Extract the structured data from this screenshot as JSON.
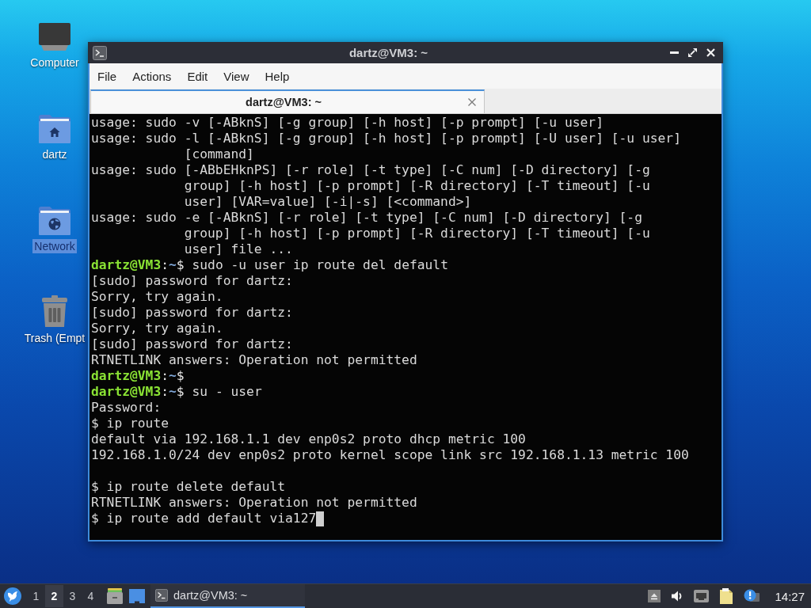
{
  "desktop_icons": [
    {
      "kind": "computer",
      "label": "Computer",
      "selected": false
    },
    {
      "kind": "home",
      "label": "dartz",
      "selected": false
    },
    {
      "kind": "network",
      "label": "Network",
      "selected": true
    },
    {
      "kind": "trash",
      "label": "Trash (Empt",
      "selected": false
    }
  ],
  "window": {
    "title": "dartz@VM3: ~",
    "menu": [
      "File",
      "Actions",
      "Edit",
      "View",
      "Help"
    ],
    "tabs": [
      {
        "label": "dartz@VM3: ~",
        "selected": true
      }
    ],
    "terminal": {
      "lines": [
        {
          "kind": "output",
          "text": "usage: sudo -v [-ABknS] [-g group] [-h host] [-p prompt] [-u user]"
        },
        {
          "kind": "output",
          "text": "usage: sudo -l [-ABknS] [-g group] [-h host] [-p prompt] [-U user] [-u user]"
        },
        {
          "kind": "continuation",
          "text": "[command]"
        },
        {
          "kind": "output",
          "text": "usage: sudo [-ABbEHknPS] [-r role] [-t type] [-C num] [-D directory] [-g"
        },
        {
          "kind": "continuation",
          "text": "group] [-h host] [-p prompt] [-R directory] [-T timeout] [-u"
        },
        {
          "kind": "continuation",
          "text": "user] [VAR=value] [-i|-s] [<command>]"
        },
        {
          "kind": "output",
          "text": "usage: sudo -e [-ABknS] [-r role] [-t type] [-C num] [-D directory] [-g"
        },
        {
          "kind": "continuation",
          "text": "group] [-h host] [-p prompt] [-R directory] [-T timeout] [-u"
        },
        {
          "kind": "continuation",
          "text": "user] file ..."
        },
        {
          "kind": "prompt",
          "host": "dartz@VM3",
          "separator": ":",
          "path": "~",
          "sign": "$",
          "command": "sudo -u user ip route del default"
        },
        {
          "kind": "output",
          "text": "[sudo] password for dartz:"
        },
        {
          "kind": "output",
          "text": "Sorry, try again."
        },
        {
          "kind": "output",
          "text": "[sudo] password for dartz:"
        },
        {
          "kind": "output",
          "text": "Sorry, try again."
        },
        {
          "kind": "output",
          "text": "[sudo] password for dartz:"
        },
        {
          "kind": "output",
          "text": "RTNETLINK answers: Operation not permitted"
        },
        {
          "kind": "prompt",
          "host": "dartz@VM3",
          "separator": ":",
          "path": "~",
          "sign": "$"
        },
        {
          "kind": "prompt",
          "host": "dartz@VM3",
          "separator": ":",
          "path": "~",
          "sign": "$",
          "command": "su - user"
        },
        {
          "kind": "output",
          "text": "Password:"
        },
        {
          "kind": "output",
          "text": "$ ip route"
        },
        {
          "kind": "output",
          "text": "default via 192.168.1.1 dev enp0s2 proto dhcp metric 100"
        },
        {
          "kind": "output",
          "text": "192.168.1.0/24 dev enp0s2 proto kernel scope link src 192.168.1.13 metric 100"
        },
        {
          "kind": "blank"
        },
        {
          "kind": "output",
          "text": "$ ip route delete default"
        },
        {
          "kind": "output",
          "text": "RTNETLINK answers: Operation not permitted"
        },
        {
          "kind": "input",
          "text": "$ ip route add default via127"
        }
      ]
    }
  },
  "taskbar": {
    "workspaces": [
      {
        "label": "1",
        "selected": false
      },
      {
        "label": "2",
        "selected": true
      },
      {
        "label": "3",
        "selected": false
      },
      {
        "label": "4",
        "selected": false
      }
    ],
    "tasks": [
      {
        "title": "dartz@VM3: ~",
        "active": true
      }
    ],
    "clock": "14:27"
  }
}
